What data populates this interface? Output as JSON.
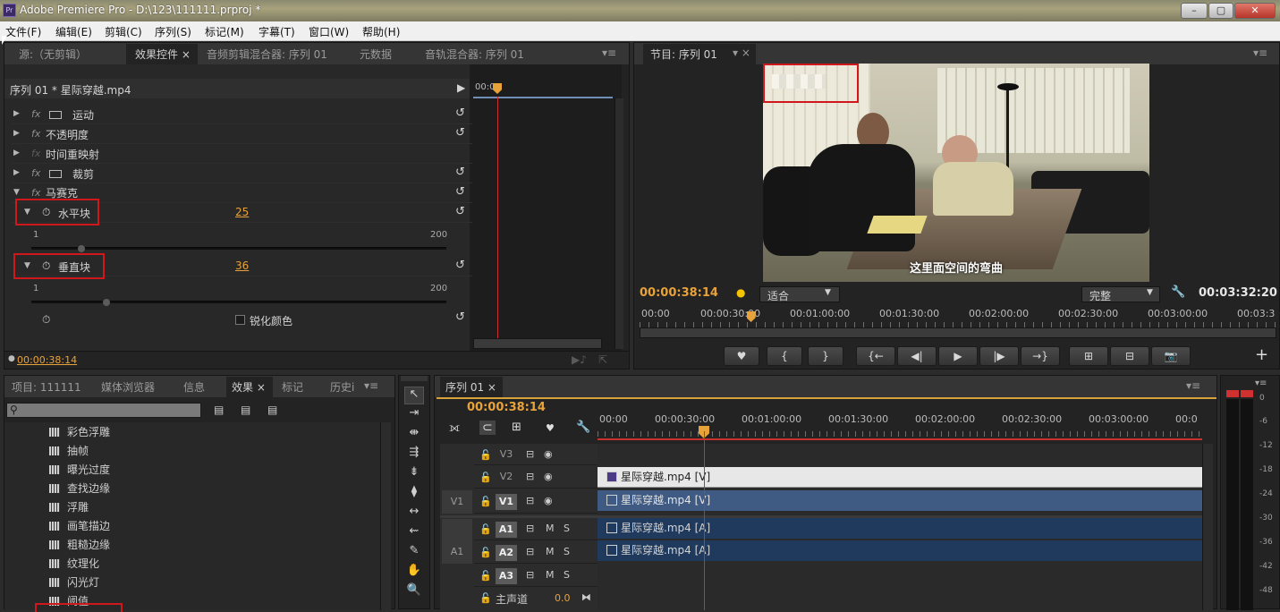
{
  "window": {
    "title": "Adobe Premiere Pro - D:\\123\\111111.prproj *",
    "icon": "Pr",
    "buttons": [
      "–",
      "▢",
      "✕"
    ]
  },
  "menu": [
    "文件(F)",
    "编辑(E)",
    "剪辑(C)",
    "序列(S)",
    "标记(M)",
    "字幕(T)",
    "窗口(W)",
    "帮助(H)"
  ],
  "source_panel": {
    "tabs": [
      "源:（无剪辑）",
      "效果控件 ×",
      "音频剪辑混合器: 序列 01",
      "元数据",
      "音轨混合器: 序列 01"
    ],
    "clip_path": "序列 01 * 星际穿越.mp4",
    "ruler_start": "00:0",
    "effects": [
      {
        "name": "运动",
        "fx": "fx"
      },
      {
        "name": "不透明度",
        "fx": "fx"
      },
      {
        "name": "时间重映射",
        "fx": "fx"
      },
      {
        "name": "裁剪",
        "fx": "fx"
      },
      {
        "name": "马赛克",
        "fx": "fx"
      }
    ],
    "params": [
      {
        "name": "水平块",
        "value": "25",
        "min": "1",
        "max": "200",
        "level": 0.12
      },
      {
        "name": "垂直块",
        "value": "36",
        "min": "1",
        "max": "200",
        "level": 0.18
      }
    ],
    "sharpen_label": "锐化颜色",
    "timecode": "00:00:38:14"
  },
  "program_monitor": {
    "tab": "节目: 序列 01",
    "subtitle": "这里面空间的弯曲",
    "timecode": "00:00:38:14",
    "fit": "适合",
    "quality": "完整",
    "duration": "00:03:32:20",
    "ruler": [
      "00:00",
      "00:00:30:00",
      "00:01:00:00",
      "00:01:30:00",
      "00:02:00:00",
      "00:02:30:00",
      "00:03:00:00",
      "00:03:3"
    ],
    "playhead_progress": 0.175,
    "controls": [
      "♥",
      "{",
      "}",
      "{←",
      "◀|",
      "▶",
      "|▶",
      "→}",
      "⊞",
      "⊟",
      "📷"
    ],
    "add_button": "+"
  },
  "project_panel": {
    "tabs": [
      "项目: 111111",
      "媒体浏览器",
      "信息",
      "效果 ×",
      "标记",
      "历史i"
    ],
    "search_icon": "search-icon",
    "items": [
      "彩色浮雕",
      "抽帧",
      "曝光过度",
      "查找边缘",
      "浮雕",
      "画笔描边",
      "粗糙边缘",
      "纹理化",
      "闪光灯",
      "阈值"
    ]
  },
  "tools": [
    "↖",
    "⇥",
    "⇼",
    "⇶",
    "⇟",
    "⧫",
    "↔",
    "⇜",
    "✎",
    "✋",
    "🔍"
  ],
  "timeline": {
    "tab": "序列 01 ×",
    "timecode": "00:00:38:14",
    "ruler": [
      "00:00",
      "00:00:30:00",
      "00:01:00:00",
      "00:01:30:00",
      "00:02:00:00",
      "00:02:30:00",
      "00:03:00:00",
      "00:0"
    ],
    "playhead_progress": 0.176,
    "video_tracks": [
      {
        "id": "V3",
        "src": ""
      },
      {
        "id": "V2",
        "src": ""
      },
      {
        "id": "V1",
        "src": "V1"
      }
    ],
    "audio_tracks": [
      {
        "id": "A1",
        "src": "A1"
      },
      {
        "id": "A2",
        "src": ""
      },
      {
        "id": "A3",
        "src": ""
      }
    ],
    "master": {
      "label": "主声道",
      "value": "0.0"
    },
    "clips": {
      "v2": "星际穿越.mp4 [V]",
      "v1": "星际穿越.mp4 [V]",
      "a1": "星际穿越.mp4 [A]",
      "a2": "星际穿越.mp4 [A]"
    }
  },
  "audio_meter": {
    "labels": [
      "0",
      "-6",
      "-12",
      "-18",
      "-24",
      "-30",
      "-36",
      "-42",
      "-48"
    ]
  },
  "colors": {
    "accent": "#e8a23a",
    "highlight": "#d0181c",
    "playhead": "#c8312d",
    "clip_video": "#e7e7e7",
    "clip_selected": "#3f5a83"
  }
}
